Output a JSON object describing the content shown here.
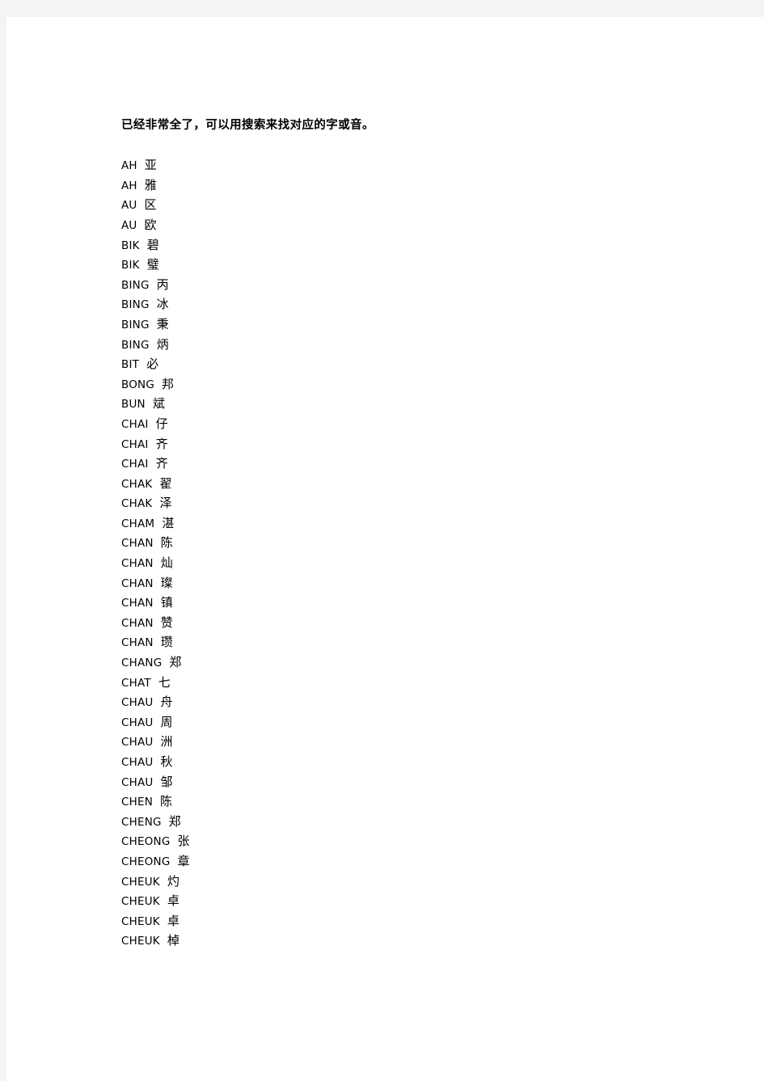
{
  "document": {
    "heading": "已经非常全了，可以用搜索来找对应的字或音。",
    "entries": [
      {
        "roman": "AH",
        "hanzi": "亚"
      },
      {
        "roman": "AH",
        "hanzi": "雅"
      },
      {
        "roman": "AU",
        "hanzi": "区"
      },
      {
        "roman": "AU",
        "hanzi": "欧"
      },
      {
        "roman": "BIK",
        "hanzi": "碧"
      },
      {
        "roman": "BIK",
        "hanzi": "璧"
      },
      {
        "roman": "BING",
        "hanzi": "丙"
      },
      {
        "roman": "BING",
        "hanzi": "冰"
      },
      {
        "roman": "BING",
        "hanzi": "秉"
      },
      {
        "roman": "BING",
        "hanzi": "炳"
      },
      {
        "roman": "BIT",
        "hanzi": "必"
      },
      {
        "roman": "BONG",
        "hanzi": "邦"
      },
      {
        "roman": "BUN",
        "hanzi": "斌"
      },
      {
        "roman": "CHAI",
        "hanzi": "仔"
      },
      {
        "roman": "CHAI",
        "hanzi": "齐"
      },
      {
        "roman": "CHAI",
        "hanzi": "齐"
      },
      {
        "roman": "CHAK",
        "hanzi": "翟"
      },
      {
        "roman": "CHAK",
        "hanzi": "泽"
      },
      {
        "roman": "CHAM",
        "hanzi": "湛"
      },
      {
        "roman": "CHAN",
        "hanzi": "陈"
      },
      {
        "roman": "CHAN",
        "hanzi": "灿"
      },
      {
        "roman": "CHAN",
        "hanzi": "璨"
      },
      {
        "roman": "CHAN",
        "hanzi": "镇"
      },
      {
        "roman": "CHAN",
        "hanzi": "赞"
      },
      {
        "roman": "CHAN",
        "hanzi": "瓒"
      },
      {
        "roman": "CHANG",
        "hanzi": "郑"
      },
      {
        "roman": "CHAT",
        "hanzi": "七"
      },
      {
        "roman": "CHAU",
        "hanzi": "舟"
      },
      {
        "roman": "CHAU",
        "hanzi": "周"
      },
      {
        "roman": "CHAU",
        "hanzi": "洲"
      },
      {
        "roman": "CHAU",
        "hanzi": "秋"
      },
      {
        "roman": "CHAU",
        "hanzi": "邹"
      },
      {
        "roman": "CHEN",
        "hanzi": "陈"
      },
      {
        "roman": "CHENG",
        "hanzi": "郑"
      },
      {
        "roman": "CHEONG",
        "hanzi": "张"
      },
      {
        "roman": "CHEONG",
        "hanzi": "章"
      },
      {
        "roman": "CHEUK",
        "hanzi": "灼"
      },
      {
        "roman": "CHEUK",
        "hanzi": "卓"
      },
      {
        "roman": "CHEUK",
        "hanzi": "卓"
      },
      {
        "roman": "CHEUK",
        "hanzi": "棹"
      }
    ]
  },
  "colors": {
    "page_background": "#ffffff",
    "outer_background": "#f4f4f4",
    "text": "#000000"
  }
}
